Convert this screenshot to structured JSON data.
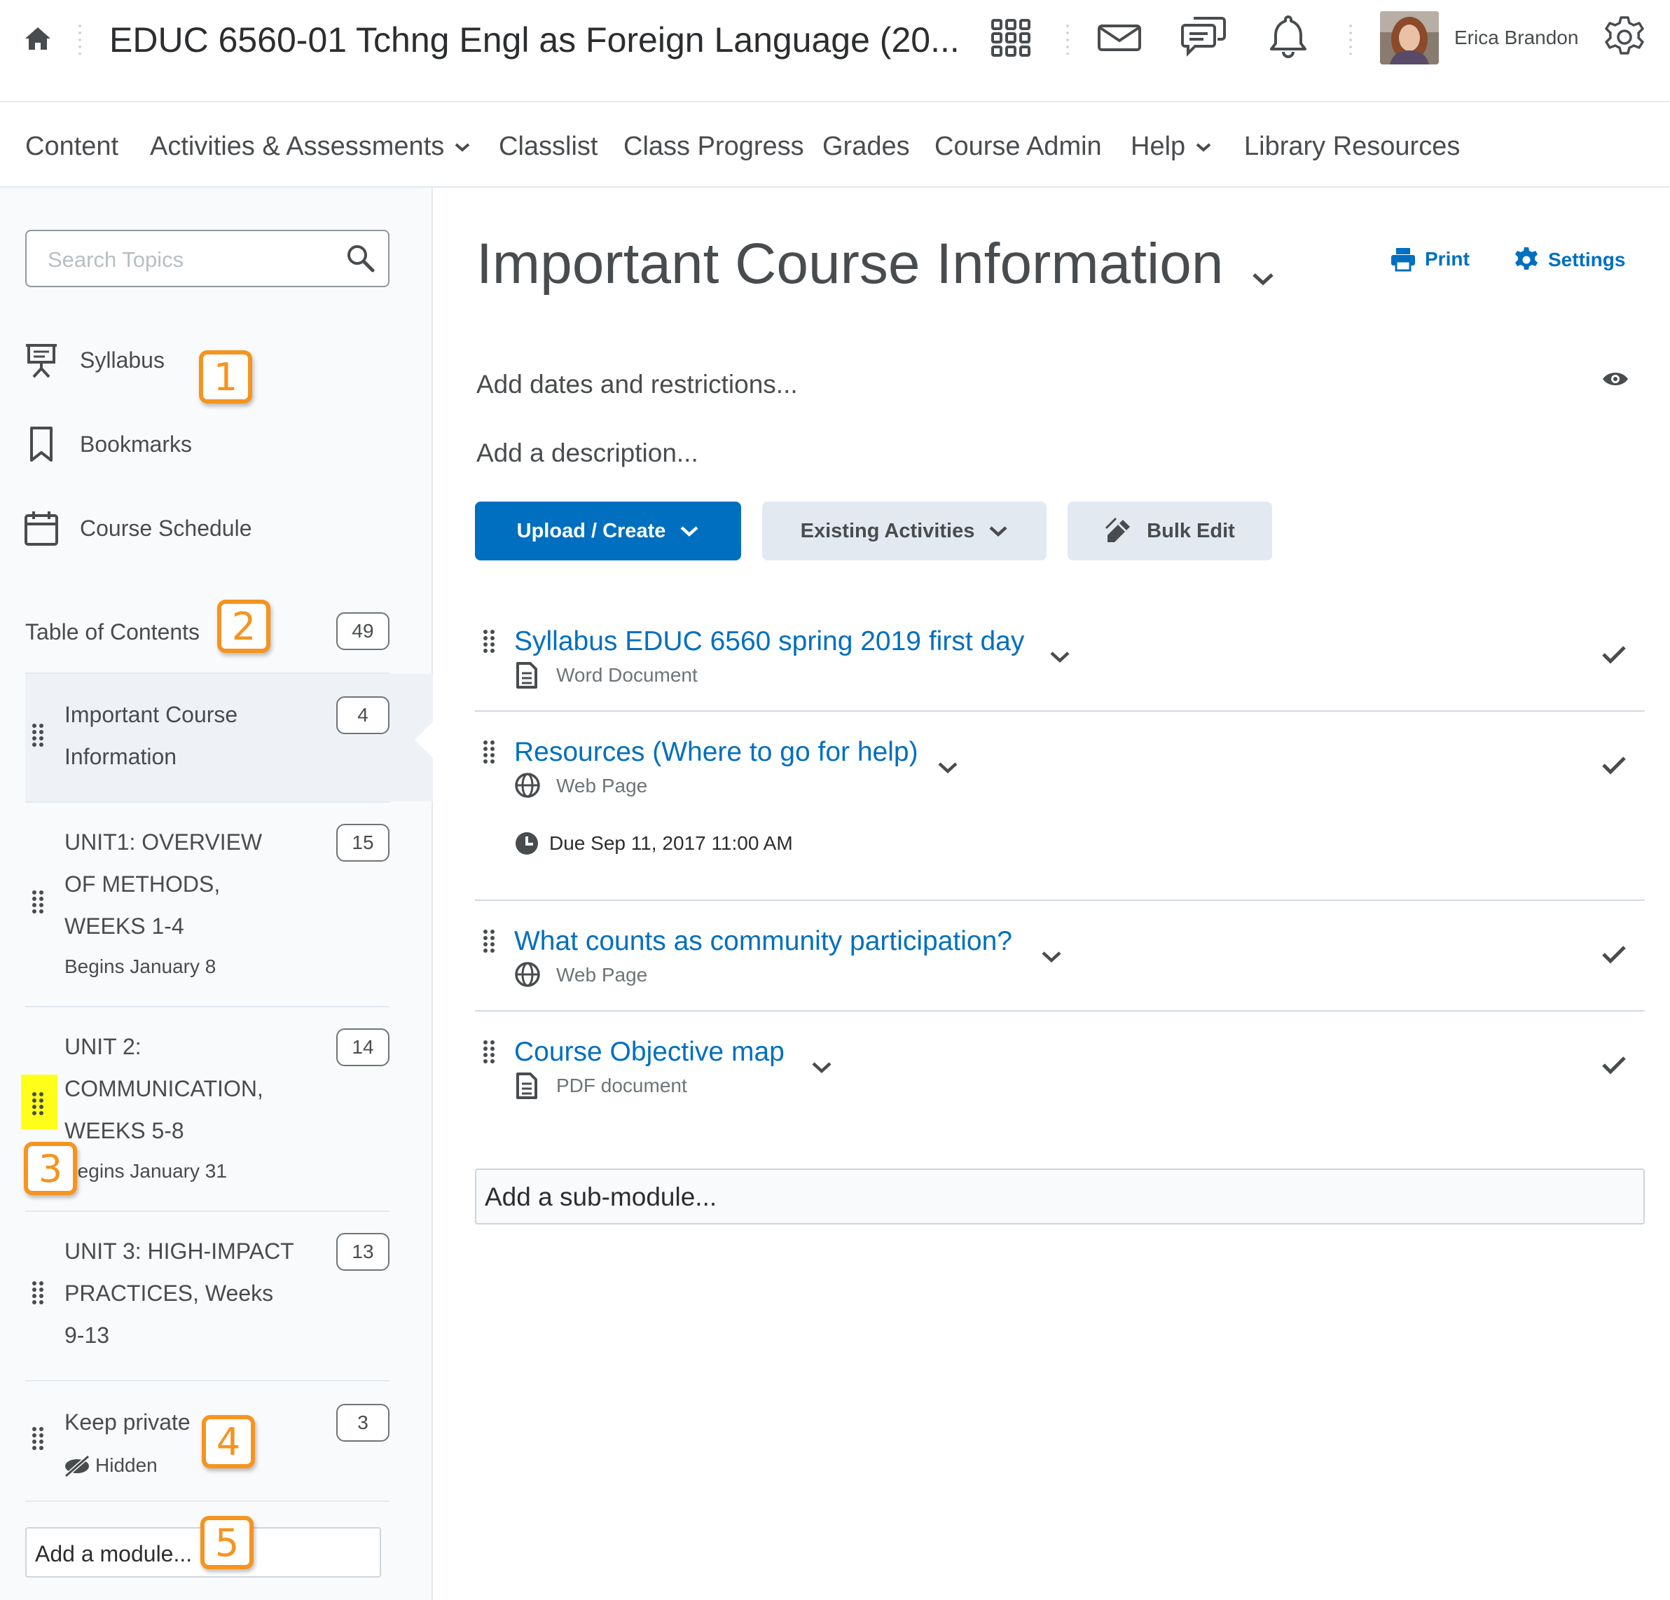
{
  "header": {
    "course_title": "EDUC 6560-01 Tchng Engl as Foreign Language (20...",
    "user_name": "Erica Brandon",
    "icons": [
      "home-icon",
      "waffle-grid-icon",
      "mail-icon",
      "chat-icon",
      "bell-icon",
      "avatar",
      "gear-icon"
    ]
  },
  "nav": {
    "items": [
      {
        "label": "Content",
        "dropdown": false
      },
      {
        "label": "Activities & Assessments",
        "dropdown": true
      },
      {
        "label": "Classlist",
        "dropdown": false
      },
      {
        "label": "Class Progress",
        "dropdown": false
      },
      {
        "label": "Grades",
        "dropdown": false
      },
      {
        "label": "Course Admin",
        "dropdown": false
      },
      {
        "label": "Help",
        "dropdown": true
      },
      {
        "label": "Library Resources",
        "dropdown": false
      }
    ]
  },
  "sidebar": {
    "search_placeholder": "Search Topics",
    "links": [
      {
        "label": "Syllabus",
        "icon": "presentation-icon"
      },
      {
        "label": "Bookmarks",
        "icon": "bookmark-icon"
      },
      {
        "label": "Course Schedule",
        "icon": "calendar-icon"
      }
    ],
    "toc_label": "Table of Contents",
    "toc_count": "49",
    "modules": [
      {
        "title": "Important Course Information",
        "count": "4",
        "subtitle": "",
        "active": true
      },
      {
        "title": "UNIT1: OVERVIEW OF METHODS, WEEKS 1-4",
        "count": "15",
        "subtitle": "Begins January 8"
      },
      {
        "title": "UNIT 2: COMMUNICATION, WEEKS 5-8",
        "count": "14",
        "subtitle": "Begins January 31"
      },
      {
        "title": "UNIT 3: HIGH-IMPACT PRACTICES, Weeks 9-13",
        "count": "13",
        "subtitle": ""
      },
      {
        "title": "Keep private",
        "count": "3",
        "subtitle": "Hidden"
      }
    ],
    "add_module": "Add a module..."
  },
  "callouts": [
    "1",
    "2",
    "3",
    "4",
    "5"
  ],
  "main": {
    "heading": "Important Course Information",
    "print_label": "Print",
    "settings_label": "Settings",
    "dates_prompt": "Add dates and restrictions...",
    "description_prompt": "Add a description...",
    "buttons": {
      "upload_create": "Upload / Create",
      "existing_activities": "Existing Activities",
      "bulk_edit": "Bulk Edit"
    },
    "topics": [
      {
        "title": "Syllabus EDUC 6560 spring 2019 first day",
        "type": "Word Document",
        "icon": "document-icon"
      },
      {
        "title": "Resources (Where to go for help)",
        "type": "Web Page",
        "icon": "globe-icon",
        "due": "Due Sep 11, 2017 11:00 AM"
      },
      {
        "title": "What counts as community participation?",
        "type": "Web Page",
        "icon": "globe-icon"
      },
      {
        "title": "Course Objective map",
        "type": "PDF document",
        "icon": "document-icon"
      }
    ],
    "add_sub_module": "Add a sub-module..."
  },
  "colors": {
    "accent_blue": "#006fbf",
    "callout_orange": "#f5941e",
    "highlight_yellow": "#ffff1a",
    "button_secondary": "#e3e9f1"
  }
}
